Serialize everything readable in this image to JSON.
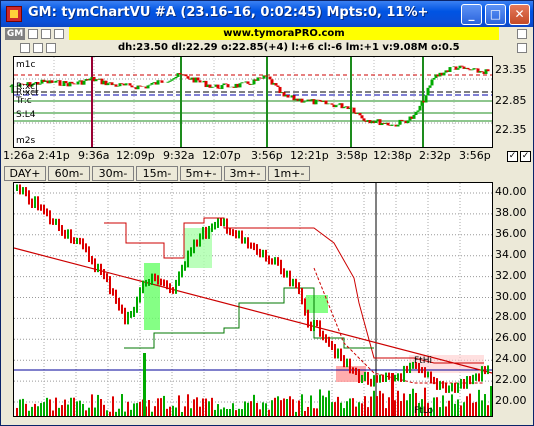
{
  "window": {
    "title": "GM: tymChartVU #A  (23.16-16, 0:02:45)  Mpts:0, 11%+"
  },
  "toolbar": {
    "symbol_badge": "GM",
    "url": "www.tymoraPRO.com"
  },
  "info_line": "dh:23.50  dl:22.29  o:22.85(+4)  l:+6  cl:-6  lm:+1  v:9.08M  o:0.5",
  "upper_chart": {
    "y_ticks": [
      "23.35",
      "22.85",
      "22.35"
    ],
    "annotations": [
      "m1c",
      "R:xcl",
      "R:xct",
      "Tr:c",
      "S:L4",
      "m2s"
    ]
  },
  "time_labels": [
    "1:26a",
    "2:41p",
    "9:36a",
    "12:09p",
    "9:32a",
    "12:07p",
    "3:56p",
    "12:21p",
    "3:58p",
    "12:38p",
    "2:32p",
    "3:56p"
  ],
  "timeframes": [
    {
      "label": "DAY+",
      "style": "sel"
    },
    {
      "label": "60m-",
      "style": "red"
    },
    {
      "label": "30m-",
      "style": "red"
    },
    {
      "label": "15m-",
      "style": "red"
    },
    {
      "label": "5m+-",
      "style": "green"
    },
    {
      "label": "3m+-",
      "style": "green"
    },
    {
      "label": "1m+-",
      "style": "green"
    }
  ],
  "lower_chart": {
    "y_ticks": [
      "40.00",
      "38.00",
      "36.00",
      "34.00",
      "32.00",
      "30.00",
      "28.00",
      "26.00",
      "24.00",
      "22.00",
      "20.00"
    ],
    "annotations": [
      "FtHi",
      "FtLo"
    ]
  },
  "colors": {
    "up": "#00aa00",
    "down": "#dd0000",
    "title_bar": "#0054e3",
    "url_bg": "#ffff00"
  }
}
